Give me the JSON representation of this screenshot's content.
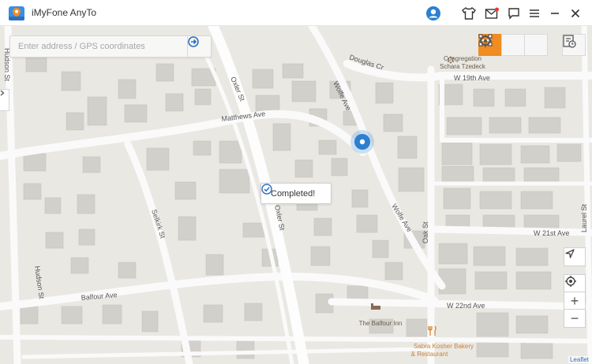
{
  "window": {
    "title": "iMyFone AnyTo",
    "buttons": [
      "user-avatar-icon",
      "skin-shirt-icon",
      "mail-icon",
      "feedback-icon",
      "menu-icon",
      "minimize-icon",
      "close-icon"
    ]
  },
  "search": {
    "placeholder": "Enter address / GPS coordinates",
    "value": ""
  },
  "modes": [
    {
      "name": "two-spot-mode",
      "icon": "route-icon",
      "active": true
    },
    {
      "name": "multi-spot-mode",
      "icon": "multi-spot-icon",
      "active": false
    },
    {
      "name": "jump-teleport-mode",
      "icon": "crosshair-icon",
      "active": false
    },
    {
      "name": "history",
      "icon": "history-icon",
      "active": false
    }
  ],
  "toast": {
    "text": "Completed!"
  },
  "map": {
    "streets": {
      "hudson_st_top": "Hudson St",
      "hudson_st_bottom": "Hudson St",
      "oxler_st_top": "Oxler St",
      "oxler_st_bottom": "Oxler St",
      "douglas_cr": "Douglas Cr",
      "w19th": "W 19th Ave",
      "wolfe_ave_top": "Wolfe Ave",
      "wolfe_ave_bottom": "Wolfe Ave",
      "matthews": "Matthews Ave",
      "selkirk": "Selkirk St",
      "oak": "Oak St",
      "w21st": "W 21st Ave",
      "balfour": "Balfour Ave",
      "w22nd": "W 22nd Ave",
      "laurel_st": "Laurel St"
    },
    "pois": {
      "congregation_line1": "Congregation",
      "congregation_line2": "Schara Tzedeck",
      "balfour_inn": "The Balfour Inn",
      "bakery_line1": "Sabra Kosher Bakery",
      "bakery_line2": "& Restaurant"
    },
    "attribution": "Leaflet",
    "colors": {
      "accent": "#f08c22",
      "marker": "#2d7fd0",
      "poi": "#c7843a"
    }
  },
  "controls": {
    "zoom_in": "+",
    "zoom_out": "−"
  }
}
